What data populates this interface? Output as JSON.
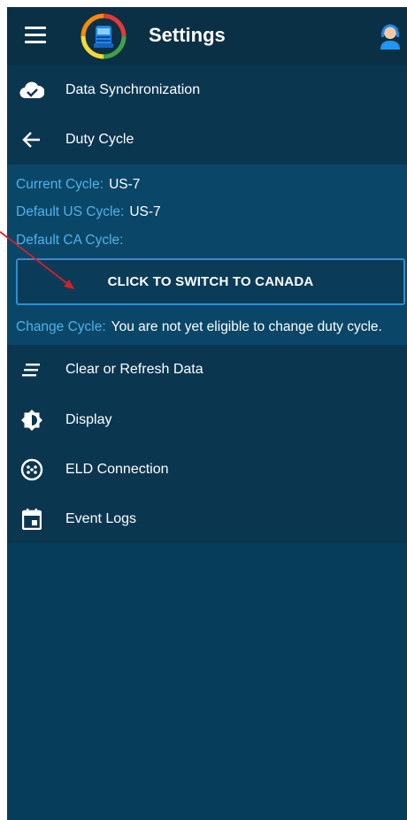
{
  "app": {
    "title": "Settings"
  },
  "icons": {
    "menu": "hamburger-menu-icon",
    "logo": "truck-logo-icon",
    "support": "support-agent-icon"
  },
  "sync": {
    "label": "Data Synchronization",
    "icon": "cloud-check-icon"
  },
  "duty": {
    "label": "Duty Cycle",
    "icon": "back-arrow-icon",
    "current_cycle_label": "Current Cycle:",
    "current_cycle_value": "US-7",
    "default_us_label": "Default US Cycle:",
    "default_us_value": "US-7",
    "default_ca_label": "Default CA Cycle:",
    "default_ca_value": "",
    "switch_button": "CLICK TO SWITCH TO CANADA",
    "change_cycle_label": "Change Cycle:",
    "change_cycle_value": "You are not yet eligible to change duty cycle."
  },
  "menu_items": [
    {
      "label": "Clear or Refresh Data",
      "icon": "clear-lines-icon"
    },
    {
      "label": "Display",
      "icon": "brightness-icon"
    },
    {
      "label": "ELD Connection",
      "icon": "connector-icon"
    },
    {
      "label": "Event Logs",
      "icon": "calendar-icon"
    }
  ],
  "colors": {
    "background": "#063d5a",
    "appbar": "#0a3046",
    "accent_label": "#4fb3ea",
    "button_border": "#2f8fd0",
    "annotation_arrow": "#d61f2c"
  }
}
